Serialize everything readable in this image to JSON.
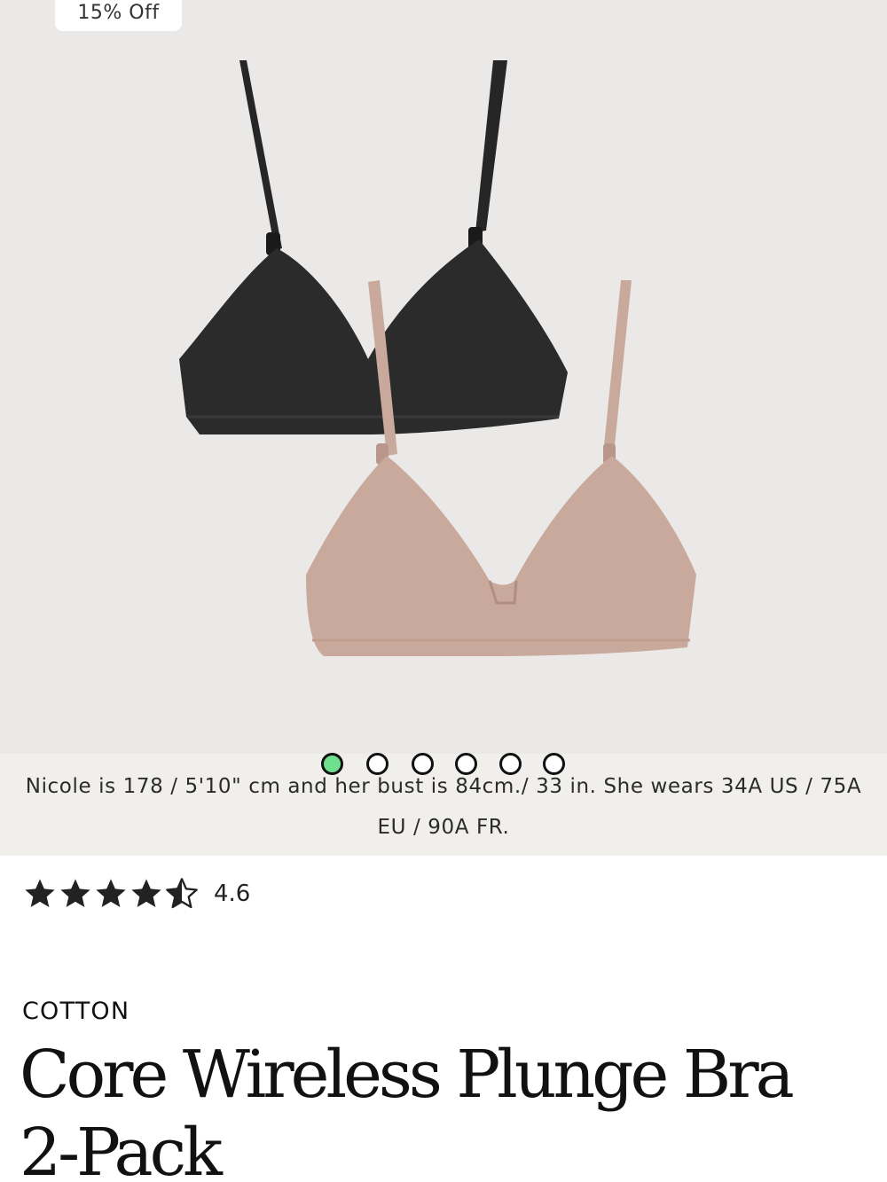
{
  "badge": {
    "discount": "15% Off"
  },
  "gallery": {
    "image_alt": "Core Wireless Plunge Bra 2-Pack in black and beige",
    "slide_count": 6,
    "active_slide": 1
  },
  "model_info": "Nicole is 178 / 5'10\" cm and her bust is 84cm./ 33 in. She wears 34A US / 75A EU / 90A FR.",
  "rating": {
    "value": "4.6",
    "stars": 4.6
  },
  "product": {
    "material": "COTTON",
    "title": "Core Wireless Plunge Bra 2-Pack"
  },
  "colors": {
    "hero_bg": "#ebe9e8",
    "active_dot": "#6ee08e",
    "black_bra": "#2b2b2b",
    "beige_bra": "#c9a99b"
  }
}
